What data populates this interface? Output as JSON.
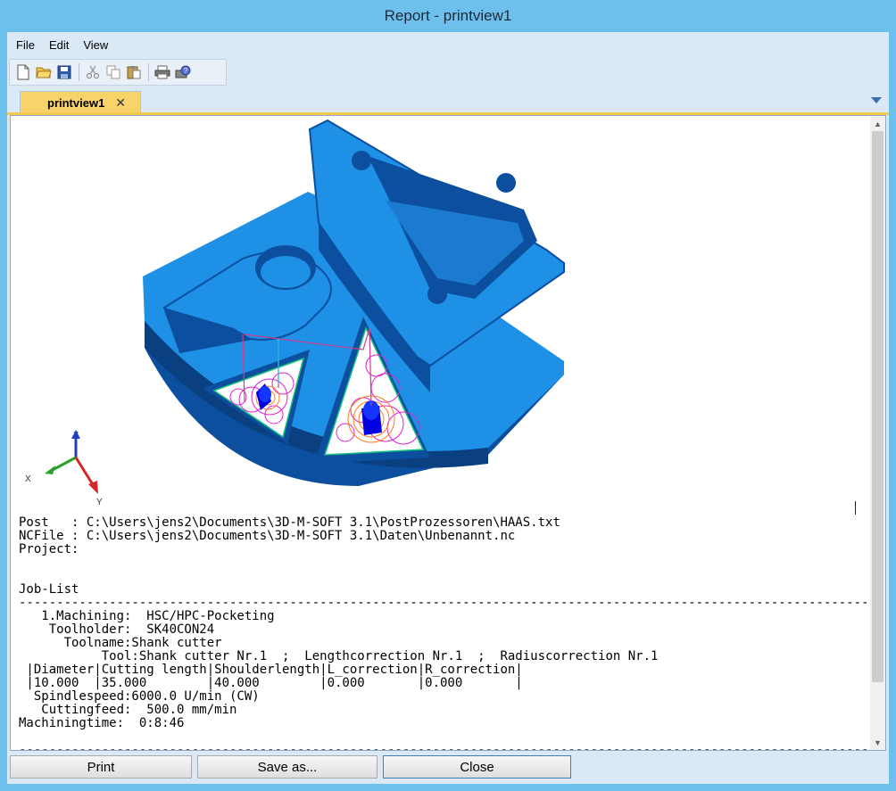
{
  "window": {
    "title": "Report - printview1"
  },
  "menu": {
    "items": [
      "File",
      "Edit",
      "View"
    ]
  },
  "toolbar": {
    "buttons": [
      "new-file-icon",
      "open-folder-icon",
      "save-icon",
      "cut-icon",
      "copy-icon",
      "paste-icon",
      "print-icon",
      "help-icon"
    ]
  },
  "tabs": [
    {
      "label": "printview1",
      "close": "✕"
    }
  ],
  "preview": {
    "axes": {
      "x": "X",
      "y": "Y",
      "z": "Z"
    },
    "colors": {
      "part": "#1e90e6",
      "part_dark": "#0b4f9e",
      "axis_x": "#2ca02c",
      "axis_y": "#d62728",
      "axis_z": "#1f3fbf"
    }
  },
  "report": {
    "lines": [
      "Post   : C:\\Users\\jens2\\Documents\\3D-M-SOFT 3.1\\PostProzessoren\\HAAS.txt",
      "NCFile : C:\\Users\\jens2\\Documents\\3D-M-SOFT 3.1\\Daten\\Unbenannt.nc",
      "Project:",
      "",
      "",
      "Job-List",
      "------------------------------------------------------------------------------------------------------------------------",
      "   1.Machining:  HSC/HPC-Pocketing",
      "    Toolholder:  SK40CON24",
      "      Toolname:Shank cutter",
      "           Tool:Shank cutter Nr.1  ;  Lengthcorrection Nr.1  ;  Radiuscorrection Nr.1",
      " |Diameter|Cutting length|Shoulderlength|L_correction|R_correction|",
      " |10.000  |35.000        |40.000        |0.000       |0.000       |",
      "  Spindlespeed:6000.0 U/min (CW)",
      "   Cuttingfeed:  500.0 mm/min",
      "Machiningtime:  0:8:46",
      "",
      "------------------------------------------------------------------------------------------------------------------------"
    ]
  },
  "buttons": {
    "print": "Print",
    "save_as": "Save as...",
    "close": "Close"
  }
}
